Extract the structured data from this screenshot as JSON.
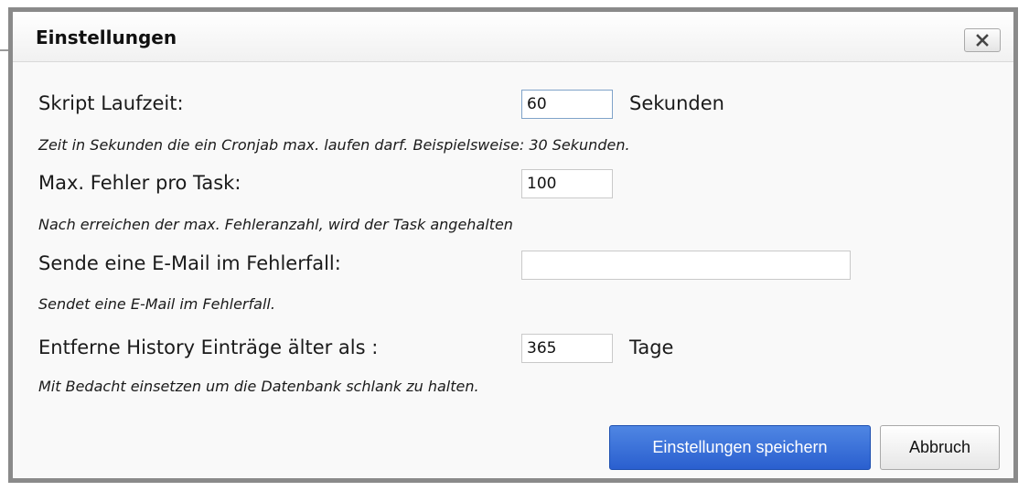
{
  "dialog": {
    "title": "Einstellungen"
  },
  "fields": {
    "script_runtime": {
      "label": "Skript Laufzeit:",
      "value": "60",
      "unit": "Sekunden",
      "hint": "Zeit in Sekunden die ein Cronjab max. laufen darf. Beispielsweise: 30 Sekunden."
    },
    "max_errors": {
      "label": "Max. Fehler pro Task:",
      "value": "100",
      "hint": "Nach erreichen der max. Fehleranzahl, wird der Task angehalten"
    },
    "error_email": {
      "label": "Sende eine E-Mail im Fehlerfall:",
      "value": "",
      "hint": "Sendet eine E-Mail im Fehlerfall."
    },
    "history_cleanup": {
      "label": "Entferne History Einträge älter als :",
      "value": "365",
      "unit": "Tage",
      "hint": "Mit Bedacht einsetzen um die Datenbank schlank zu halten."
    }
  },
  "buttons": {
    "save_label": "Einstellungen speichern",
    "cancel_label": "Abbruch"
  },
  "icons": {
    "close": "close-icon"
  },
  "colors": {
    "primary_button": "#2f65d4",
    "dialog_border": "#8a8a8a"
  }
}
